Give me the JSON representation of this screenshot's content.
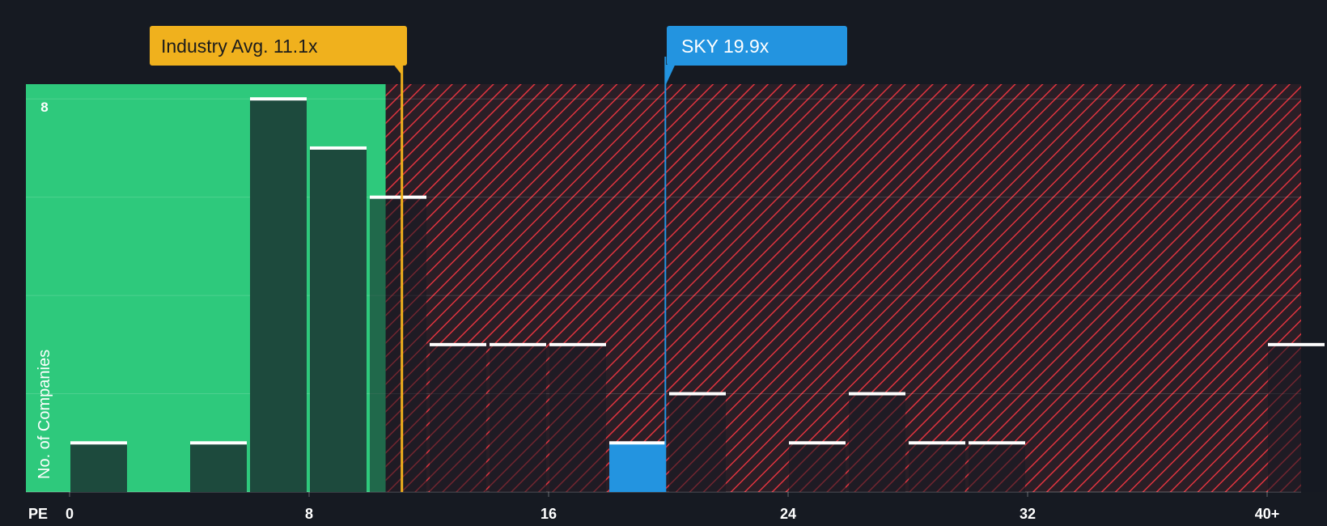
{
  "colors": {
    "background": "#161a22",
    "fair_zone": "#2ec97c",
    "overvalued_zone": "#e0343f",
    "bar_fill": "#1d4a3d",
    "bar_highlight": "#2394e0",
    "industry_avg": "#f0b11d",
    "company": "#2394e0"
  },
  "chart_data": {
    "type": "bar",
    "xlabel": "PE",
    "ylabel": "No. of Companies",
    "xlim": [
      0,
      41
    ],
    "ylim": [
      0,
      8.3
    ],
    "x_tick_labels": [
      "0",
      "8",
      "16",
      "24",
      "32",
      "40+"
    ],
    "x_tick_values": [
      0,
      8,
      16,
      24,
      32,
      40
    ],
    "y_tick_labels": [
      "8"
    ],
    "y_tick_values": [
      8
    ],
    "grid": true,
    "bin_width": 2,
    "bins": [
      {
        "start": 0,
        "count": 1
      },
      {
        "start": 4,
        "count": 1
      },
      {
        "start": 6,
        "count": 8
      },
      {
        "start": 8,
        "count": 7
      },
      {
        "start": 10,
        "count": 6
      },
      {
        "start": 12,
        "count": 3
      },
      {
        "start": 14,
        "count": 3
      },
      {
        "start": 16,
        "count": 3
      },
      {
        "start": 18,
        "count": 1,
        "highlight": true
      },
      {
        "start": 20,
        "count": 2
      },
      {
        "start": 24,
        "count": 1
      },
      {
        "start": 26,
        "count": 2
      },
      {
        "start": 28,
        "count": 1
      },
      {
        "start": 30,
        "count": 1
      },
      {
        "start": 40,
        "count": 3
      }
    ],
    "markers": {
      "industry_avg": {
        "label": "Industry Avg. 11.1x",
        "value": 11.1
      },
      "company": {
        "label": "SKY 19.9x",
        "value": 19.9
      }
    }
  }
}
